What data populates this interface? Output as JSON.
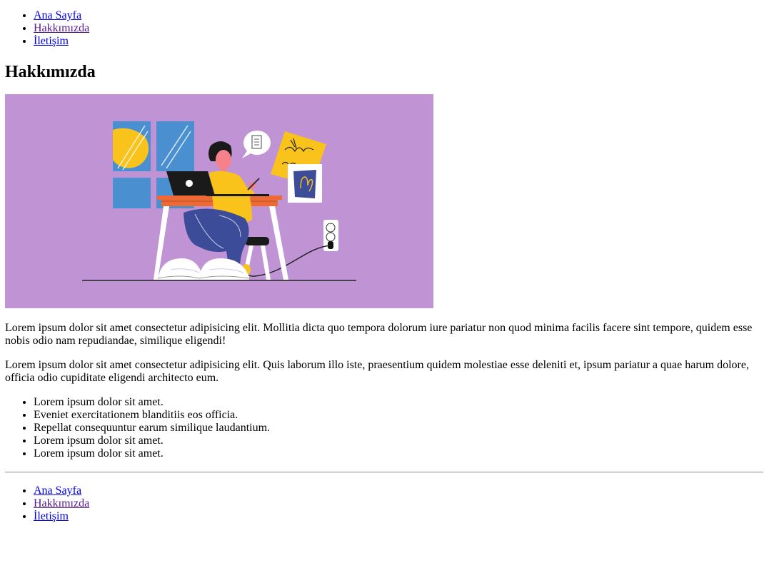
{
  "header": {
    "nav": [
      {
        "label": "Ana Sayfa"
      },
      {
        "label": "Hakkımızda"
      },
      {
        "label": "İletişim"
      }
    ]
  },
  "main": {
    "title": "Hakkımızda",
    "image": {
      "subject": "woman-working-on-laptop-illustration",
      "background_color": "#bf93d4",
      "colors": {
        "yellow": "#f9c31b",
        "blue": "#4a90d0",
        "navy": "#3d4c99",
        "orange": "#ee6a35",
        "dark": "#1a1a1a"
      }
    },
    "paragraphs": [
      "Lorem ipsum dolor sit amet consectetur adipisicing elit. Mollitia dicta quo tempora dolorum iure pariatur non quod minima facilis facere sint tempore, quidem esse nobis odio nam repudiandae, similique eligendi!",
      "Lorem ipsum dolor sit amet consectetur adipisicing elit. Quis laborum illo iste, praesentium quidem molestiae esse deleniti et, ipsum pariatur a quae harum dolore, officia odio cupiditate eligendi architecto eum."
    ],
    "bullets": [
      "Lorem ipsum dolor sit amet.",
      "Eveniet exercitationem blanditiis eos officia.",
      "Repellat consequuntur earum similique laudantium.",
      "Lorem ipsum dolor sit amet.",
      "Lorem ipsum dolor sit amet."
    ]
  },
  "footer": {
    "nav": [
      {
        "label": "Ana Sayfa"
      },
      {
        "label": "Hakkımızda"
      },
      {
        "label": "İletişim"
      }
    ]
  },
  "colors": {
    "link": "#0000ee",
    "visited_link": "#551a8b"
  }
}
